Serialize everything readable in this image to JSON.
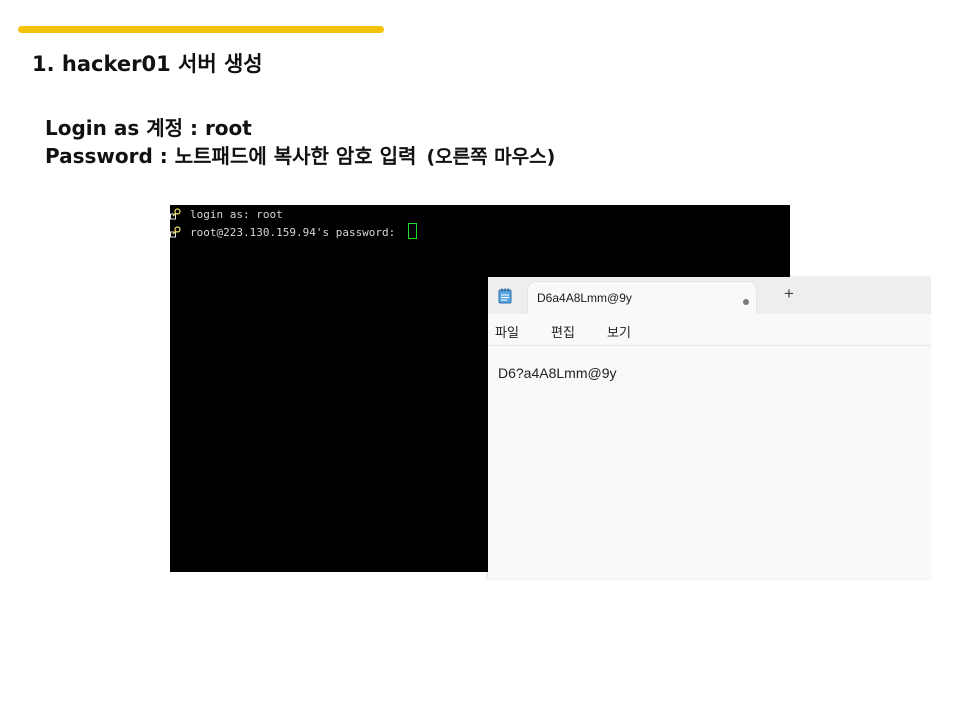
{
  "slide": {
    "title": "1. hacker01 서버 생성",
    "login_line": "Login as 계정 : root",
    "password_line": "Password : 노트패드에 복사한 암호 입력",
    "password_note": "(오른쪽 마우스)",
    "accent_color": "#F5C20B"
  },
  "terminal": {
    "lines": [
      {
        "icon": "key-icon",
        "text": "login as: root"
      },
      {
        "icon": "key-icon",
        "text": "root@223.130.159.94's password: "
      }
    ],
    "background": "#000000",
    "cursor_color": "#22E02A"
  },
  "notepad": {
    "app_icon": "notepad-icon",
    "tab_title": "D6a4A8Lmm@9y",
    "new_tab_symbol": "+",
    "menu": {
      "file": "파일",
      "edit": "편집",
      "view": "보기"
    },
    "content": "D6?a4A8Lmm@9y"
  }
}
